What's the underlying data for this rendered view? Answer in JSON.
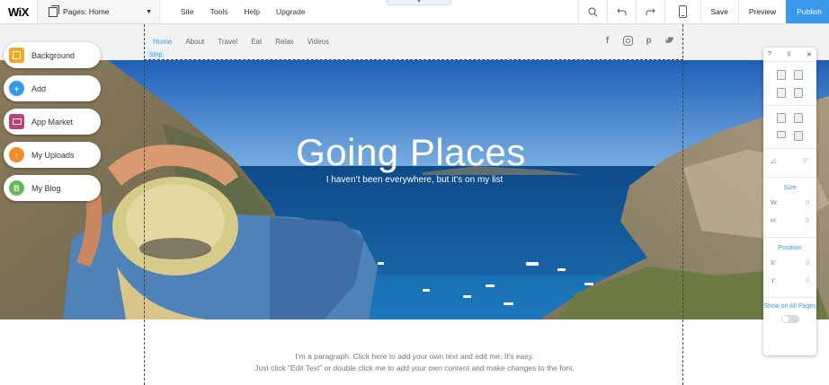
{
  "app": {
    "logo": "WiX"
  },
  "topbar": {
    "pages_label": "Pages: Home",
    "menu": [
      "Site",
      "Tools",
      "Help",
      "Upgrade"
    ],
    "save": "Save",
    "preview": "Preview",
    "publish": "Publish",
    "icons": [
      "zoom-icon",
      "undo-icon",
      "redo-icon",
      "mobile-icon"
    ]
  },
  "site": {
    "nav": [
      "Home",
      "About",
      "Travel",
      "Eat",
      "Relax",
      "Videos"
    ],
    "strip_label": "Strip",
    "social_icons": [
      "facebook-icon",
      "instagram-icon",
      "pinterest-icon",
      "twitter-icon"
    ],
    "hero_title": "Going Places",
    "hero_subtitle": "I haven’t been everywhere, but it’s on my list",
    "paragraph_line1": "I’m a paragraph. Click here to add your own text and edit me. It’s easy.",
    "paragraph_line2": "Just click “Edit Text” or double click me to add your own content and make changes to the font."
  },
  "left_panel": [
    {
      "label": "Background",
      "icon": "background-icon",
      "color": "#f5a623"
    },
    {
      "label": "Add",
      "icon": "add-icon",
      "color": "#3899ec"
    },
    {
      "label": "App Market",
      "icon": "app-market-icon",
      "color": "#c2407a"
    },
    {
      "label": "My Uploads",
      "icon": "upload-icon",
      "color": "#f08a2a"
    },
    {
      "label": "My Blog",
      "icon": "blog-icon",
      "color": "#60bc57"
    }
  ],
  "inspector": {
    "help": "?",
    "angle": "0°",
    "size_title": "Size",
    "w_label": "W:",
    "w_value": "0",
    "h_label": "H:",
    "h_value": "0",
    "position_title": "Position",
    "x_label": "X:",
    "x_value": "0",
    "y_label": "Y:",
    "y_value": "0",
    "show_on_all_pages": "Show on All Pages"
  },
  "colors": {
    "accent": "#3899ec",
    "publish_bg": "#3899ec"
  }
}
